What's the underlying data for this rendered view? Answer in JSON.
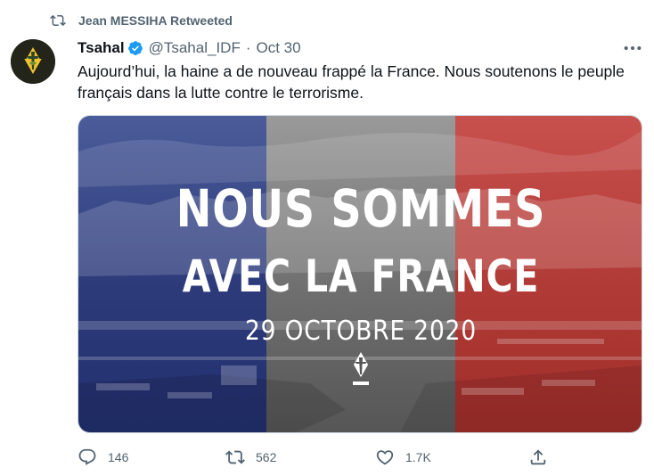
{
  "retweet": {
    "icon": "retweet-icon",
    "text": "Jean MESSIHA Retweeted"
  },
  "tweet": {
    "author": {
      "name": "Tsahal",
      "handle": "@Tsahal_IDF",
      "verified": true,
      "avatar_icon": "idf-emblem-icon"
    },
    "separator": "·",
    "date": "Oct 30",
    "text": "Aujourd’hui, la haine a de nouveau frappé la France. Nous soutenons le peuple français dans la lutte contre le terrorisme."
  },
  "media": {
    "line1": "NOUS SOMMES",
    "line2": "AVEC LA FRANCE",
    "line3": "29 OCTOBRE 2020",
    "colors": {
      "blue": "#2c3a7a",
      "grey": "#6f6f6f",
      "red": "#b03a36"
    }
  },
  "actions": {
    "reply": {
      "icon": "reply-icon",
      "count": "146"
    },
    "retweet": {
      "icon": "retweet-icon",
      "count": "562"
    },
    "like": {
      "icon": "heart-icon",
      "count": "1.7K"
    },
    "share": {
      "icon": "share-icon"
    }
  },
  "colors": {
    "accent": "#1d9bf0",
    "secondary_text": "#536471"
  }
}
